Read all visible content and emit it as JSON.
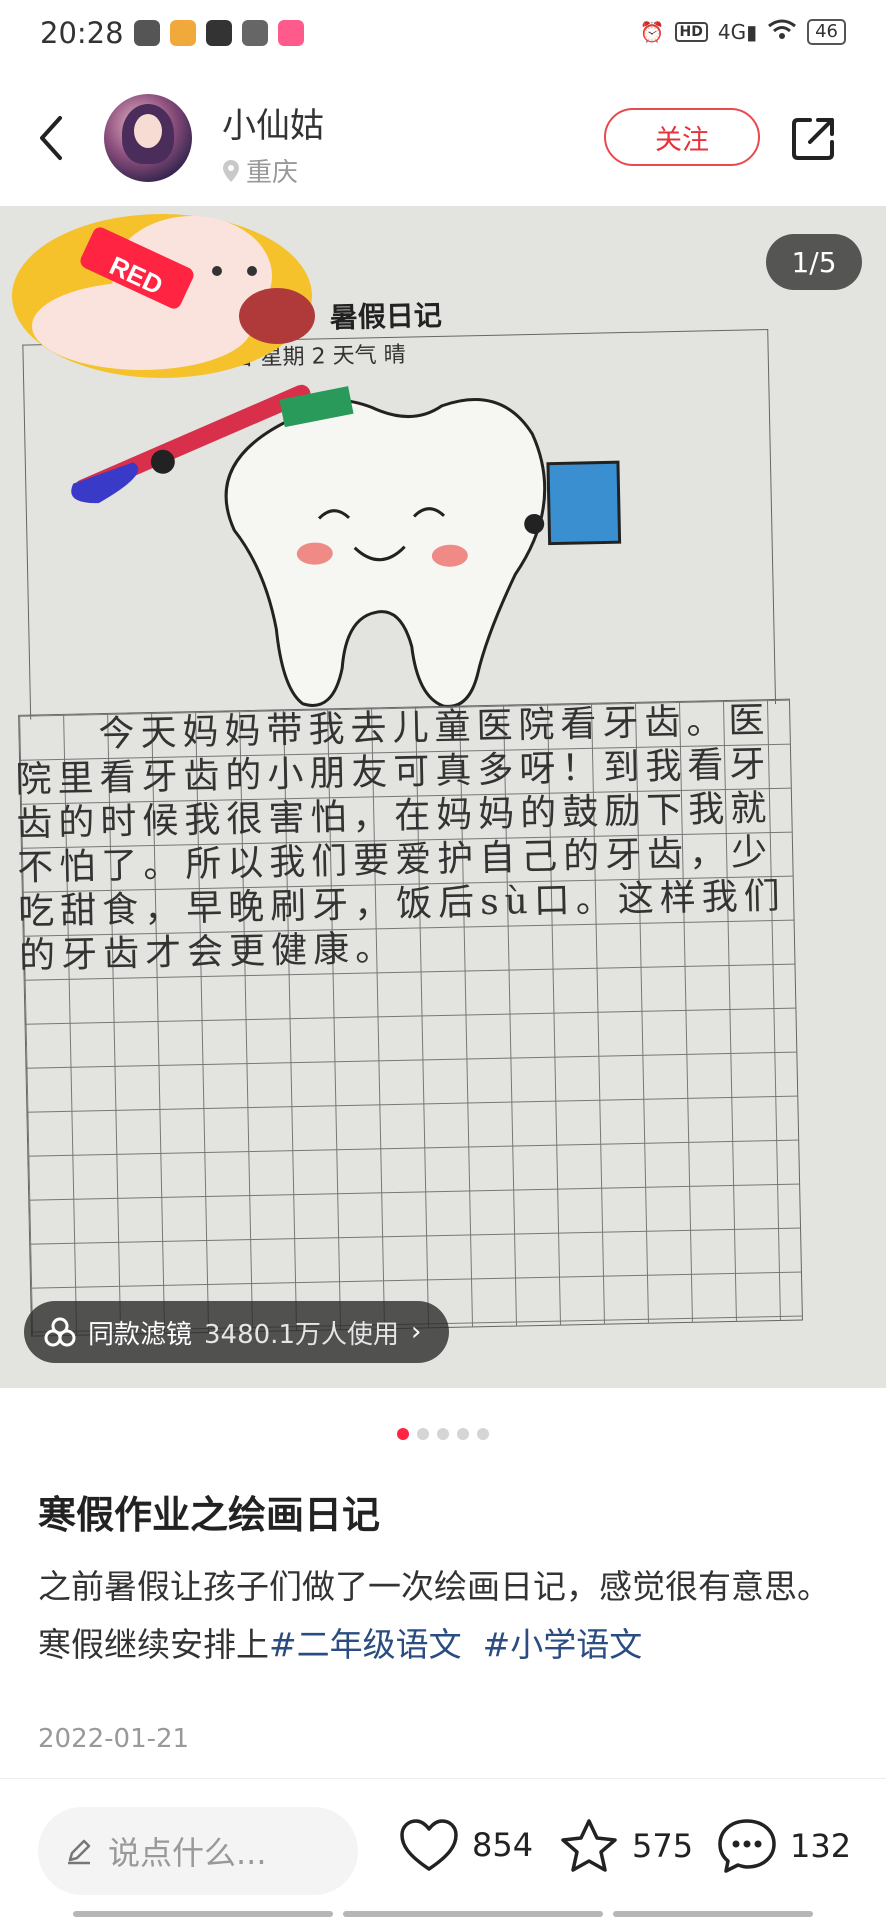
{
  "status_bar": {
    "time": "20:28",
    "battery": "46",
    "network": "4G"
  },
  "header": {
    "back_icon": "chevron-left-icon",
    "username": "小仙姑",
    "location": "重庆",
    "follow_label": "关注",
    "share_icon": "share-icon"
  },
  "photo": {
    "page_indicator": "1/5",
    "sticker_text": "RED",
    "paper_title": "暑假日记",
    "paper_date": "6 月 3 日 星期 2 天气 晴",
    "diary_text": "　　今天妈妈带我去儿童医院看牙齿。医院里看牙齿的小朋友可真多呀！到我看牙齿的时候我很害怕，在妈妈的鼓励下我就不怕了。所以我们要爱护自己的牙齿，少吃甜食，早晚刷牙，饭后sù口。这样我们的牙齿才会更健康。",
    "filter_label": "同款滤镜",
    "filter_users": "3480.1万人使用"
  },
  "carousel": {
    "count": 5,
    "active": 0
  },
  "post": {
    "title": "寒假作业之绘画日记",
    "body": "之前暑假让孩子们做了一次绘画日记，感觉很有意思。寒假继续安排上",
    "tags": [
      "#二年级语文",
      "#小学语文"
    ],
    "date": "2022-01-21"
  },
  "bottom_bar": {
    "comment_placeholder": "说点什么...",
    "likes": "854",
    "collects": "575",
    "comments": "132"
  },
  "colors": {
    "accent": "#ff2442",
    "follow": "#e5333b",
    "hashtag": "#2a4c80"
  }
}
